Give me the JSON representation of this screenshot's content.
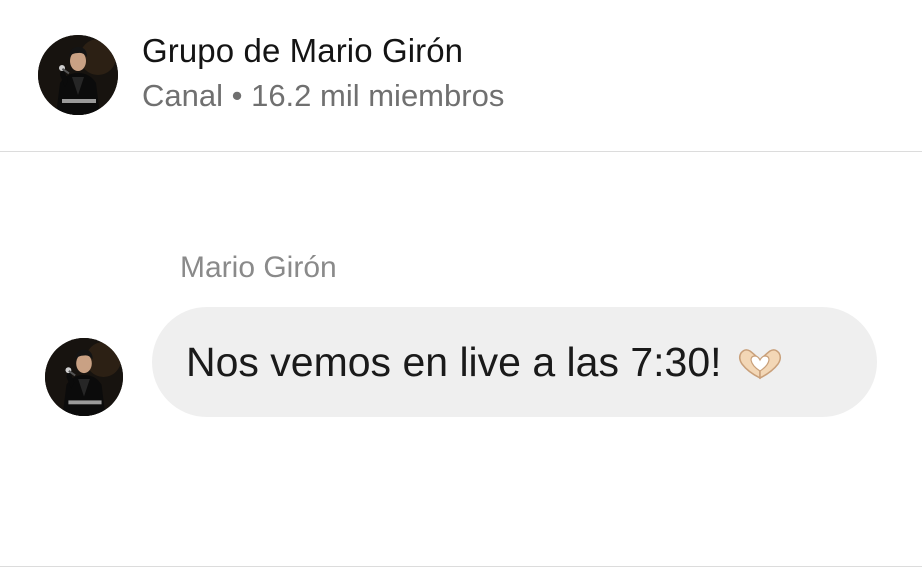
{
  "header": {
    "channel_name": "Grupo de Mario Girón",
    "channel_meta": "Canal • 16.2 mil miembros",
    "avatar_icon": "singer-portrait-avatar"
  },
  "message": {
    "sender": "Mario Girón",
    "text": "Nos vemos en live a las 7:30!",
    "emoji_icon": "heart-hands-icon",
    "bubble_color": "#efefef"
  }
}
